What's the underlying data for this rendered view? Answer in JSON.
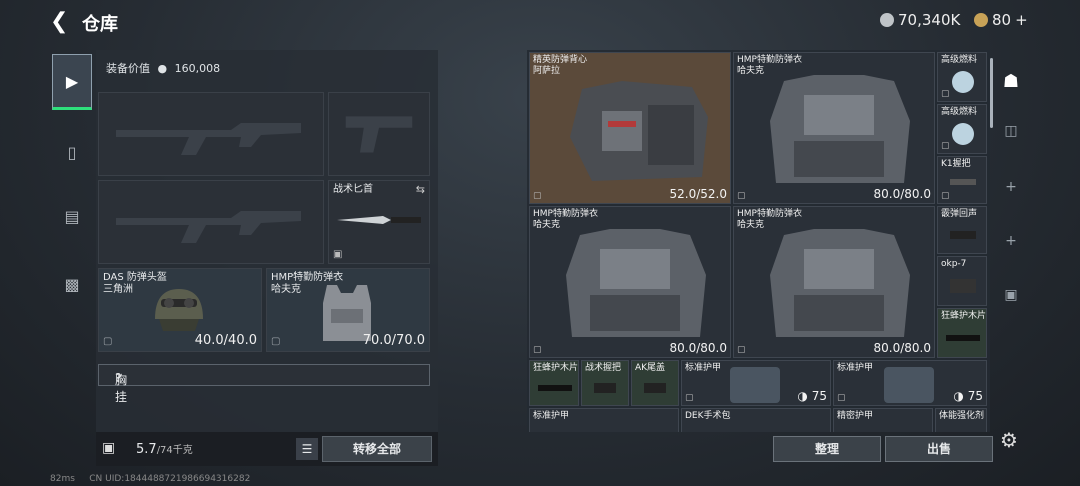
{
  "header": {
    "title": "仓库",
    "currency1": "70,340K",
    "currency2": "80",
    "plus": "+"
  },
  "left": {
    "equip_value_label": "装备价值",
    "equip_value": "160,008",
    "knife_label": "战术匕首",
    "helmet_label": "DAS 防弹头盔",
    "helmet_sub": "三角洲",
    "helmet_dur": "40.0/40.0",
    "vest_label": "HMP特勤防弹衣",
    "vest_sub": "哈夫克",
    "vest_dur": "70.0/70.0",
    "chest_label": "胸挂",
    "chest_q": "?",
    "weight": "5.7",
    "weight_max": "/74千克",
    "transfer_all": "转移全部"
  },
  "grid": {
    "items": [
      {
        "name": "精英防弹背心",
        "sub": "阿萨拉",
        "dur": "52.0/52.0"
      },
      {
        "name": "HMP特勤防弹衣",
        "sub": "哈夫克",
        "dur": "80.0/80.0"
      },
      {
        "name": "HMP特勤防弹衣",
        "sub": "哈夫克",
        "dur": "80.0/80.0"
      },
      {
        "name": "HMP特勤防弹衣",
        "sub": "哈夫克",
        "dur": "80.0/80.0"
      }
    ],
    "small": [
      {
        "name": "高级燃料"
      },
      {
        "name": "高级燃料"
      },
      {
        "name": "K1握把"
      },
      {
        "name": "霰弹回声"
      },
      {
        "name": "okp-7"
      },
      {
        "name": "狂蜂护木片"
      },
      {
        "name": "狂蜂护木片"
      },
      {
        "name": "战术握把"
      },
      {
        "name": "AK尾盖"
      },
      {
        "name": "标准护甲",
        "val": "75"
      },
      {
        "name": "标准护甲",
        "val": "75"
      },
      {
        "name": "标准护甲"
      },
      {
        "name": "DEK手术包"
      },
      {
        "name": "精密护甲"
      },
      {
        "name": "体能强化剂"
      }
    ]
  },
  "buttons": {
    "sort": "整理",
    "sell": "出售"
  },
  "status": {
    "ping": "82ms",
    "uid": "CN UID:1844488721986694316282"
  }
}
